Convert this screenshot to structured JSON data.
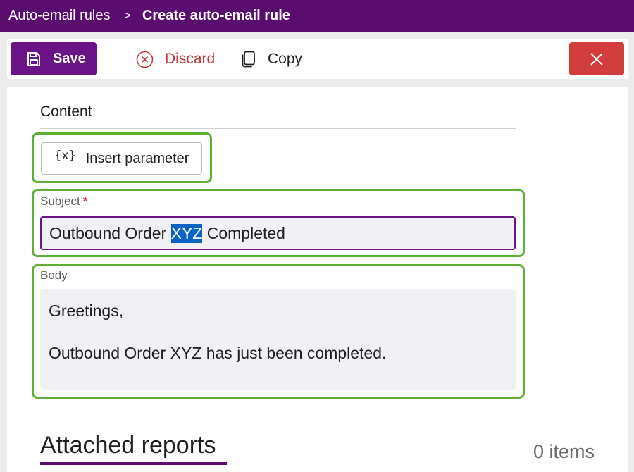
{
  "breadcrumb": {
    "parent": "Auto-email rules",
    "separator": ">",
    "current": "Create auto-email rule"
  },
  "toolbar": {
    "save_label": "Save",
    "discard_label": "Discard",
    "copy_label": "Copy",
    "icons": {
      "save": "save-icon",
      "discard": "discard-icon",
      "copy": "copy-icon",
      "close": "close-icon"
    }
  },
  "content": {
    "section_title": "Content",
    "insert_parameter": {
      "icon_glyph": "{x}",
      "label": "Insert parameter"
    },
    "subject": {
      "label": "Subject",
      "required_mark": "*",
      "value_before": "Outbound Order ",
      "value_selected": "XYZ",
      "value_after": " Completed"
    },
    "body": {
      "label": "Body",
      "lines": [
        "Greetings,",
        "",
        "Outbound Order XYZ has just been completed."
      ]
    }
  },
  "attached_reports": {
    "title": "Attached reports",
    "count_text": "0 items"
  },
  "colors": {
    "header_bg": "#5a0c6f",
    "primary_button": "#6b1488",
    "discard_red": "#c2393a",
    "close_button": "#d13c3c",
    "highlight_green": "#5fae35",
    "selection_blue": "#0a64c8"
  }
}
